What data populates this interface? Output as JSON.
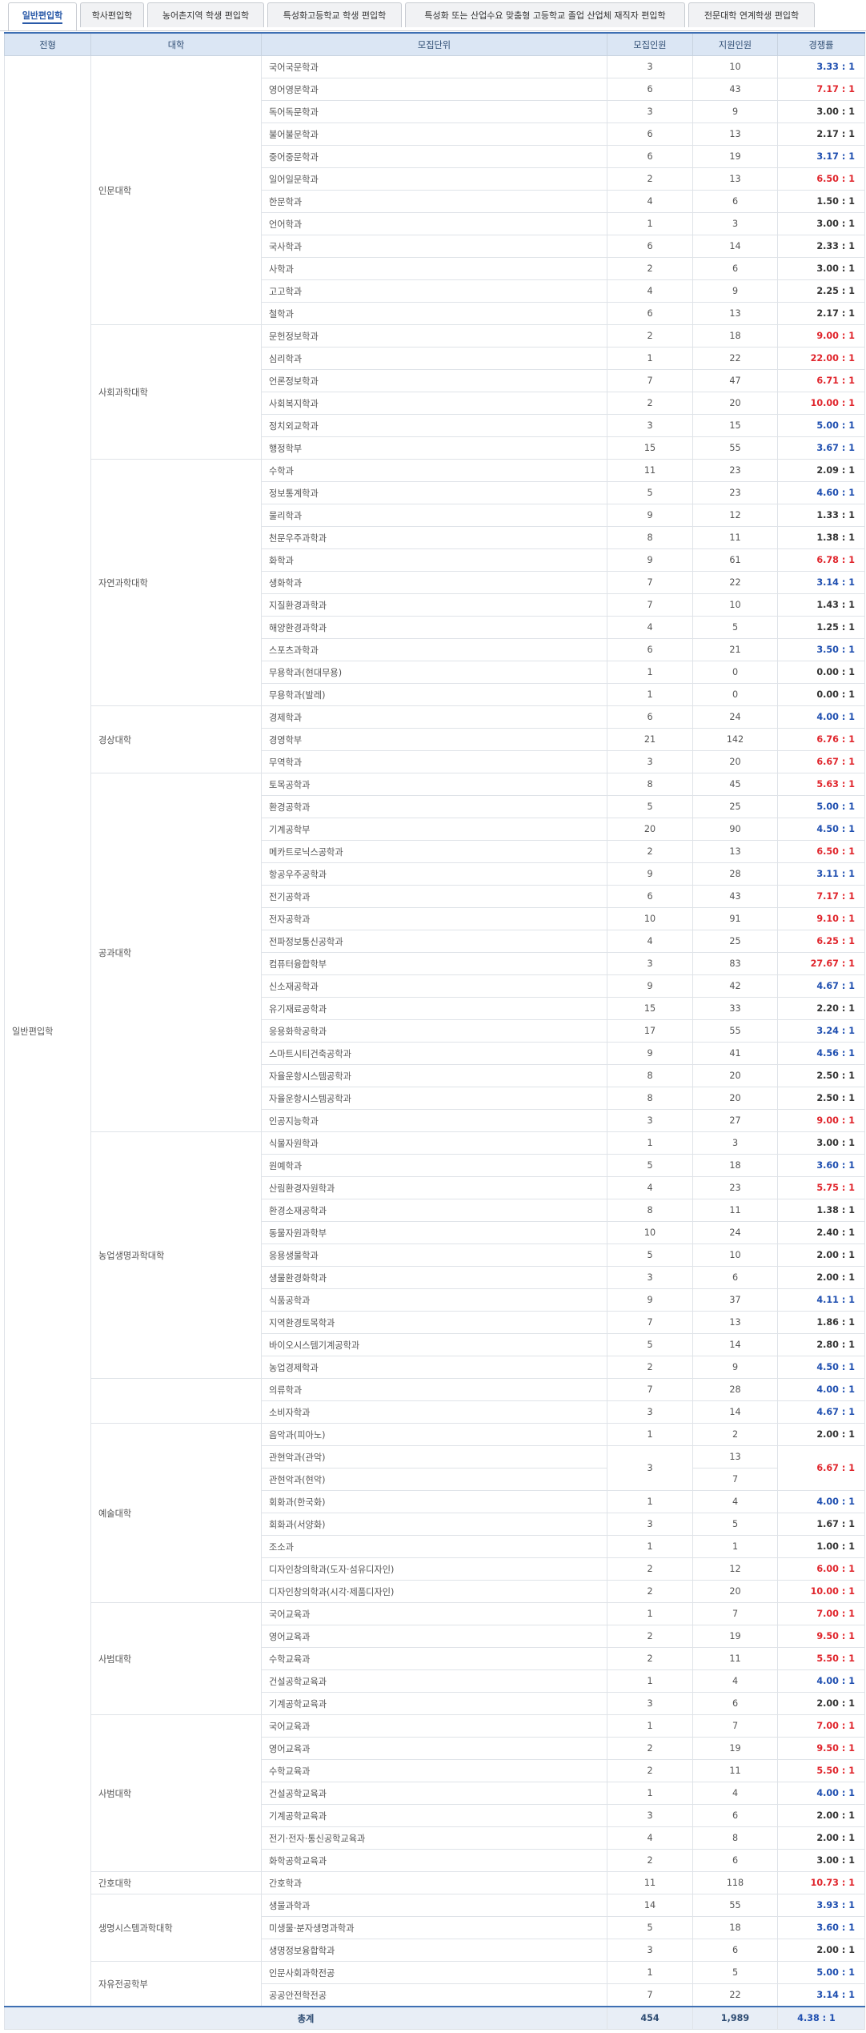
{
  "tabs": [
    {
      "label": "일반편입학",
      "active": true
    },
    {
      "label": "학사편입학"
    },
    {
      "label": "농어촌지역 학생 편입학"
    },
    {
      "label": "특성화고등학교 학생 편입학"
    },
    {
      "label": "특성화 또는 산업수요 맞춤형 고등학교 졸업 산업체 재직자 편입학"
    },
    {
      "label": "전문대학 연계학생 편입학"
    }
  ],
  "headers": [
    "전형",
    "대학",
    "모집단위",
    "모집인원",
    "지원인원",
    "경쟁률"
  ],
  "track": "일반편입학",
  "colleges": [
    {
      "name": "인문대학",
      "units": [
        {
          "u": "국어국문학과",
          "r": "3",
          "a": "10",
          "c": "3.33 : 1",
          "cls": "blue"
        },
        {
          "u": "영어영문학과",
          "r": "6",
          "a": "43",
          "c": "7.17 : 1",
          "cls": "red"
        },
        {
          "u": "독어독문학과",
          "r": "3",
          "a": "9",
          "c": "3.00 : 1",
          "cls": "dark"
        },
        {
          "u": "불어불문학과",
          "r": "6",
          "a": "13",
          "c": "2.17 : 1",
          "cls": "dark"
        },
        {
          "u": "중어중문학과",
          "r": "6",
          "a": "19",
          "c": "3.17 : 1",
          "cls": "blue"
        },
        {
          "u": "일어일문학과",
          "r": "2",
          "a": "13",
          "c": "6.50 : 1",
          "cls": "red"
        },
        {
          "u": "한문학과",
          "r": "4",
          "a": "6",
          "c": "1.50 : 1",
          "cls": "dark"
        },
        {
          "u": "언어학과",
          "r": "1",
          "a": "3",
          "c": "3.00 : 1",
          "cls": "dark"
        },
        {
          "u": "국사학과",
          "r": "6",
          "a": "14",
          "c": "2.33 : 1",
          "cls": "dark"
        },
        {
          "u": "사학과",
          "r": "2",
          "a": "6",
          "c": "3.00 : 1",
          "cls": "dark"
        },
        {
          "u": "고고학과",
          "r": "4",
          "a": "9",
          "c": "2.25 : 1",
          "cls": "dark"
        },
        {
          "u": "철학과",
          "r": "6",
          "a": "13",
          "c": "2.17 : 1",
          "cls": "dark"
        }
      ]
    },
    {
      "name": "사회과학대학",
      "units": [
        {
          "u": "문헌정보학과",
          "r": "2",
          "a": "18",
          "c": "9.00 : 1",
          "cls": "red"
        },
        {
          "u": "심리학과",
          "r": "1",
          "a": "22",
          "c": "22.00 : 1",
          "cls": "red"
        },
        {
          "u": "언론정보학과",
          "r": "7",
          "a": "47",
          "c": "6.71 : 1",
          "cls": "red"
        },
        {
          "u": "사회복지학과",
          "r": "2",
          "a": "20",
          "c": "10.00 : 1",
          "cls": "red"
        },
        {
          "u": "정치외교학과",
          "r": "3",
          "a": "15",
          "c": "5.00 : 1",
          "cls": "blue"
        },
        {
          "u": "행정학부",
          "r": "15",
          "a": "55",
          "c": "3.67 : 1",
          "cls": "blue"
        }
      ]
    },
    {
      "name": "자연과학대학",
      "units": [
        {
          "u": "수학과",
          "r": "11",
          "a": "23",
          "c": "2.09 : 1",
          "cls": "dark"
        },
        {
          "u": "정보통계학과",
          "r": "5",
          "a": "23",
          "c": "4.60 : 1",
          "cls": "blue"
        },
        {
          "u": "물리학과",
          "r": "9",
          "a": "12",
          "c": "1.33 : 1",
          "cls": "dark"
        },
        {
          "u": "천문우주과학과",
          "r": "8",
          "a": "11",
          "c": "1.38 : 1",
          "cls": "dark"
        },
        {
          "u": "화학과",
          "r": "9",
          "a": "61",
          "c": "6.78 : 1",
          "cls": "red"
        },
        {
          "u": "생화학과",
          "r": "7",
          "a": "22",
          "c": "3.14 : 1",
          "cls": "blue"
        },
        {
          "u": "지질환경과학과",
          "r": "7",
          "a": "10",
          "c": "1.43 : 1",
          "cls": "dark"
        },
        {
          "u": "해양환경과학과",
          "r": "4",
          "a": "5",
          "c": "1.25 : 1",
          "cls": "dark"
        },
        {
          "u": "스포츠과학과",
          "r": "6",
          "a": "21",
          "c": "3.50 : 1",
          "cls": "blue"
        },
        {
          "u": "무용학과(현대무용)",
          "r": "1",
          "a": "0",
          "c": "0.00 : 1",
          "cls": "dark"
        },
        {
          "u": "무용학과(발레)",
          "r": "1",
          "a": "0",
          "c": "0.00 : 1",
          "cls": "dark"
        }
      ]
    },
    {
      "name": "경상대학",
      "units": [
        {
          "u": "경제학과",
          "r": "6",
          "a": "24",
          "c": "4.00 : 1",
          "cls": "blue"
        },
        {
          "u": "경영학부",
          "r": "21",
          "a": "142",
          "c": "6.76 : 1",
          "cls": "red"
        },
        {
          "u": "무역학과",
          "r": "3",
          "a": "20",
          "c": "6.67 : 1",
          "cls": "red"
        }
      ]
    },
    {
      "name": "공과대학",
      "units": [
        {
          "u": "토목공학과",
          "r": "8",
          "a": "45",
          "c": "5.63 : 1",
          "cls": "red"
        },
        {
          "u": "환경공학과",
          "r": "5",
          "a": "25",
          "c": "5.00 : 1",
          "cls": "blue"
        },
        {
          "u": "기계공학부",
          "r": "20",
          "a": "90",
          "c": "4.50 : 1",
          "cls": "blue"
        },
        {
          "u": "메카트로닉스공학과",
          "r": "2",
          "a": "13",
          "c": "6.50 : 1",
          "cls": "red"
        },
        {
          "u": "항공우주공학과",
          "r": "9",
          "a": "28",
          "c": "3.11 : 1",
          "cls": "blue"
        },
        {
          "u": "전기공학과",
          "r": "6",
          "a": "43",
          "c": "7.17 : 1",
          "cls": "red"
        },
        {
          "u": "전자공학과",
          "r": "10",
          "a": "91",
          "c": "9.10 : 1",
          "cls": "red"
        },
        {
          "u": "전파정보통신공학과",
          "r": "4",
          "a": "25",
          "c": "6.25 : 1",
          "cls": "red"
        },
        {
          "u": "컴퓨터융합학부",
          "r": "3",
          "a": "83",
          "c": "27.67 : 1",
          "cls": "red"
        },
        {
          "u": "신소재공학과",
          "r": "9",
          "a": "42",
          "c": "4.67 : 1",
          "cls": "blue"
        },
        {
          "u": "유기재료공학과",
          "r": "15",
          "a": "33",
          "c": "2.20 : 1",
          "cls": "dark"
        },
        {
          "u": "응용화학공학과",
          "r": "17",
          "a": "55",
          "c": "3.24 : 1",
          "cls": "blue"
        },
        {
          "u": "스마트시티건축공학과",
          "r": "9",
          "a": "41",
          "c": "4.56 : 1",
          "cls": "blue"
        },
        {
          "u": "자율운항시스템공학과",
          "r": "8",
          "a": "20",
          "c": "2.50 : 1",
          "cls": "dark"
        },
        {
          "u": "자율운항시스템공학과",
          "r": "8",
          "a": "20",
          "c": "2.50 : 1",
          "cls": "dark"
        },
        {
          "u": "인공지능학과",
          "r": "3",
          "a": "27",
          "c": "9.00 : 1",
          "cls": "red"
        }
      ]
    },
    {
      "name": "농업생명과학대학",
      "units": [
        {
          "u": "식물자원학과",
          "r": "1",
          "a": "3",
          "c": "3.00 : 1",
          "cls": "dark"
        },
        {
          "u": "원예학과",
          "r": "5",
          "a": "18",
          "c": "3.60 : 1",
          "cls": "blue"
        },
        {
          "u": "산림환경자원학과",
          "r": "4",
          "a": "23",
          "c": "5.75 : 1",
          "cls": "red"
        },
        {
          "u": "환경소재공학과",
          "r": "8",
          "a": "11",
          "c": "1.38 : 1",
          "cls": "dark"
        },
        {
          "u": "동물자원과학부",
          "r": "10",
          "a": "24",
          "c": "2.40 : 1",
          "cls": "dark"
        },
        {
          "u": "응용생물학과",
          "r": "5",
          "a": "10",
          "c": "2.00 : 1",
          "cls": "dark"
        },
        {
          "u": "생물환경화학과",
          "r": "3",
          "a": "6",
          "c": "2.00 : 1",
          "cls": "dark"
        },
        {
          "u": "식품공학과",
          "r": "9",
          "a": "37",
          "c": "4.11 : 1",
          "cls": "blue"
        },
        {
          "u": "지역환경토목학과",
          "r": "7",
          "a": "13",
          "c": "1.86 : 1",
          "cls": "dark"
        },
        {
          "u": "바이오시스템기계공학과",
          "r": "5",
          "a": "14",
          "c": "2.80 : 1",
          "cls": "dark"
        },
        {
          "u": "농업경제학과",
          "r": "2",
          "a": "9",
          "c": "4.50 : 1",
          "cls": "blue"
        }
      ]
    },
    {
      "name": "",
      "units": [
        {
          "u": "의류학과",
          "r": "7",
          "a": "28",
          "c": "4.00 : 1",
          "cls": "blue"
        },
        {
          "u": "소비자학과",
          "r": "3",
          "a": "14",
          "c": "4.67 : 1",
          "cls": "blue"
        }
      ]
    },
    {
      "name": "예술대학",
      "units": [
        {
          "u": "음악과(피아노)",
          "r": "1",
          "a": "2",
          "c": "2.00 : 1",
          "cls": "dark"
        },
        {
          "u": "관현악과(관악)",
          "r": "3",
          "a": "13",
          "c": "6.67 : 1",
          "cls": "red",
          "span": 2
        },
        {
          "u": "관현악과(현악)",
          "a": "7"
        },
        {
          "u": "회화과(한국화)",
          "r": "1",
          "a": "4",
          "c": "4.00 : 1",
          "cls": "blue"
        },
        {
          "u": "회화과(서양화)",
          "r": "3",
          "a": "5",
          "c": "1.67 : 1",
          "cls": "dark"
        },
        {
          "u": "조소과",
          "r": "1",
          "a": "1",
          "c": "1.00 : 1",
          "cls": "dark"
        },
        {
          "u": "디자인창의학과(도자·섬유디자인)",
          "r": "2",
          "a": "12",
          "c": "6.00 : 1",
          "cls": "red"
        },
        {
          "u": "디자인창의학과(시각·제품디자인)",
          "r": "2",
          "a": "20",
          "c": "10.00 : 1",
          "cls": "red"
        }
      ]
    },
    {
      "name": "사범대학",
      "units": [
        {
          "u": "국어교육과",
          "r": "1",
          "a": "7",
          "c": "7.00 : 1",
          "cls": "red"
        },
        {
          "u": "영어교육과",
          "r": "2",
          "a": "19",
          "c": "9.50 : 1",
          "cls": "red"
        },
        {
          "u": "수학교육과",
          "r": "2",
          "a": "11",
          "c": "5.50 : 1",
          "cls": "red"
        },
        {
          "u": "건설공학교육과",
          "r": "1",
          "a": "4",
          "c": "4.00 : 1",
          "cls": "blue"
        },
        {
          "u": "기계공학교육과",
          "r": "3",
          "a": "6",
          "c": "2.00 : 1",
          "cls": "dark"
        }
      ]
    },
    {
      "name": "사범대학",
      "units": [
        {
          "u": "국어교육과",
          "r": "1",
          "a": "7",
          "c": "7.00 : 1",
          "cls": "red"
        },
        {
          "u": "영어교육과",
          "r": "2",
          "a": "19",
          "c": "9.50 : 1",
          "cls": "red"
        },
        {
          "u": "수학교육과",
          "r": "2",
          "a": "11",
          "c": "5.50 : 1",
          "cls": "red"
        },
        {
          "u": "건설공학교육과",
          "r": "1",
          "a": "4",
          "c": "4.00 : 1",
          "cls": "blue"
        },
        {
          "u": "기계공학교육과",
          "r": "3",
          "a": "6",
          "c": "2.00 : 1",
          "cls": "dark"
        },
        {
          "u": "전기·전자·통신공학교육과",
          "r": "4",
          "a": "8",
          "c": "2.00 : 1",
          "cls": "dark"
        },
        {
          "u": "화학공학교육과",
          "r": "2",
          "a": "6",
          "c": "3.00 : 1",
          "cls": "dark"
        }
      ]
    },
    {
      "name": "간호대학",
      "units": [
        {
          "u": "간호학과",
          "r": "11",
          "a": "118",
          "c": "10.73 : 1",
          "cls": "red"
        }
      ]
    },
    {
      "name": "생명시스템과학대학",
      "units": [
        {
          "u": "생물과학과",
          "r": "14",
          "a": "55",
          "c": "3.93 : 1",
          "cls": "blue"
        },
        {
          "u": "미생물·분자생명과학과",
          "r": "5",
          "a": "18",
          "c": "3.60 : 1",
          "cls": "blue"
        },
        {
          "u": "생명정보융합학과",
          "r": "3",
          "a": "6",
          "c": "2.00 : 1",
          "cls": "dark"
        }
      ]
    },
    {
      "name": "자유전공학부",
      "units": [
        {
          "u": "인문사회과학전공",
          "r": "1",
          "a": "5",
          "c": "5.00 : 1",
          "cls": "blue"
        },
        {
          "u": "공공안전학전공",
          "r": "7",
          "a": "22",
          "c": "3.14 : 1",
          "cls": "blue"
        }
      ]
    }
  ],
  "footer": {
    "label": "총계",
    "recruit": "454",
    "applied": "1,989",
    "ratio": "4.38 : 1"
  }
}
